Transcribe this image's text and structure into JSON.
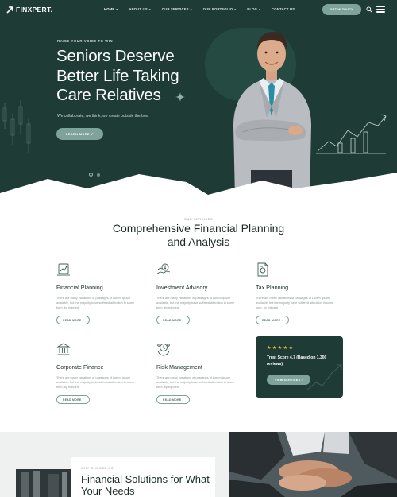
{
  "nav": {
    "logo": "FINXPERT.",
    "items": [
      {
        "label": "HOME",
        "active": true
      },
      {
        "label": "ABOUT US",
        "active": false
      },
      {
        "label": "OUR SERVICES",
        "active": false
      },
      {
        "label": "OUR PORTFOLIO",
        "active": false
      },
      {
        "label": "BLOG",
        "active": false
      },
      {
        "label": "CONTACT US",
        "active": false
      }
    ],
    "cta": "GET IN TOUCH"
  },
  "hero": {
    "eyebrow": "RAISE YOUR VOICE TO WIN",
    "title": "Seniors Deserve Better Life Taking Care Relatives",
    "subtitle": "We collaborate, we think, we create outside the box.",
    "button": "LEARN MORE"
  },
  "services": {
    "eyebrow": "OUR SERVICES",
    "title": "Comprehensive Financial Planning and Analysis",
    "cards": [
      {
        "title": "Financial Planning",
        "icon": "financial-planning-icon",
        "text": "There are many variations of passages of Lorem Ipsum available, but the majority have suffered alteration in some form, by injected",
        "button": "READ MORE"
      },
      {
        "title": "Investment Advisory",
        "icon": "investment-advisory-icon",
        "text": "There are many variations of passages of Lorem Ipsum available, but the majority have suffered alteration in some form, by injected",
        "button": "READ MORE"
      },
      {
        "title": "Tax Planning",
        "icon": "tax-planning-icon",
        "text": "There are many variations of passages of Lorem Ipsum available, but the majority have suffered alteration in some form, by injected",
        "button": "READ MORE"
      },
      {
        "title": "Corporate Finance",
        "icon": "corporate-finance-icon",
        "text": "There are many variations of passages of Lorem Ipsum available, but the majority have suffered alteration in some form, by injected",
        "button": "READ MORE"
      },
      {
        "title": "Risk Management",
        "icon": "risk-management-icon",
        "text": "There are many variations of passages of Lorem Ipsum available, but the majority have suffered alteration in some form, by injected",
        "button": "READ MORE"
      }
    ],
    "trust": {
      "stars": 5,
      "text": "Trust Score 4.7 (Based on 1,300 reviews)",
      "button": "VIEW SERVICES"
    }
  },
  "why": {
    "eyebrow": "WHY CHOOSE US",
    "title": "Financial Solutions for What Your Needs"
  },
  "colors": {
    "primary_dark": "#1e3b35",
    "accent": "#7fa39a",
    "star": "#f2c230"
  }
}
